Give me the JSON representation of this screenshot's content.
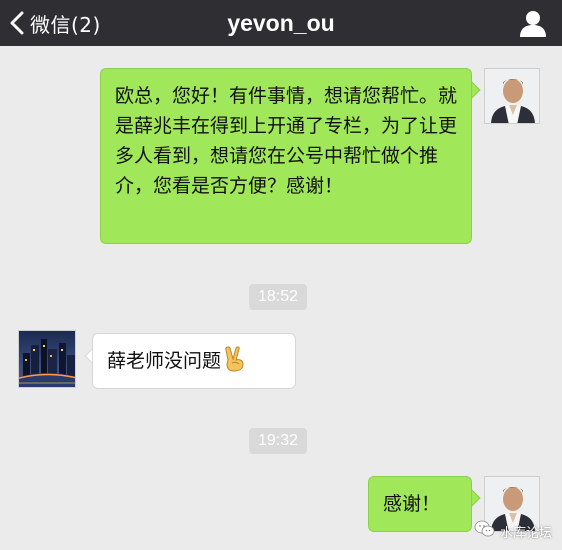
{
  "header": {
    "back_label": "微信(2)",
    "title": "yevon_ou",
    "profile_icon": "person-icon"
  },
  "messages": [
    {
      "direction": "sent",
      "text": "欧总，您好！有件事情，想请您帮忙。就是薛兆丰在得到上开通了专栏，为了让更多人看到，想请您在公号中帮忙做个推介，您看是否方便？感谢！"
    },
    {
      "type": "timestamp",
      "text": "18:52"
    },
    {
      "direction": "received",
      "text": "薛老师没问题",
      "emoji": "victory-hand"
    },
    {
      "type": "timestamp",
      "text": "19:32"
    },
    {
      "direction": "sent",
      "text": "感谢！"
    }
  ],
  "watermark": {
    "text": "水库论坛"
  },
  "colors": {
    "header_bg": "#2f2f33",
    "chat_bg": "#ebebeb",
    "sent_bubble": "#a0e75a",
    "received_bubble": "#ffffff",
    "timestamp_bg": "#d9d9d9"
  }
}
